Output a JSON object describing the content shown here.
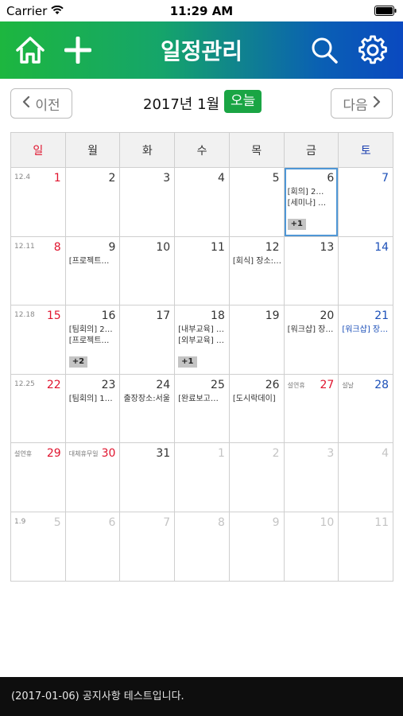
{
  "status": {
    "carrier": "Carrier",
    "time": "11:29 AM"
  },
  "appbar": {
    "title": "일정관리",
    "icons": [
      "home-icon",
      "plus-icon",
      "search-icon",
      "gear-icon"
    ],
    "gradient": [
      "#1db63f",
      "#0a49c0"
    ]
  },
  "nav": {
    "prev_label": "이전",
    "next_label": "다음",
    "month_title": "2017년 1월",
    "today_label": "오늘"
  },
  "weekdays": [
    "일",
    "월",
    "화",
    "수",
    "목",
    "금",
    "토"
  ],
  "weeks": [
    {
      "label": "12.4",
      "days": [
        {
          "num": "1",
          "type": "sun"
        },
        {
          "num": "2"
        },
        {
          "num": "3"
        },
        {
          "num": "4"
        },
        {
          "num": "5"
        },
        {
          "num": "6",
          "selected": true,
          "events": [
            "[회의] 2…",
            "[세미나] …"
          ],
          "more": "+1"
        },
        {
          "num": "7",
          "type": "sat"
        }
      ]
    },
    {
      "label": "12.11",
      "days": [
        {
          "num": "8",
          "type": "sun"
        },
        {
          "num": "9",
          "events": [
            "[프로젝트…"
          ]
        },
        {
          "num": "10"
        },
        {
          "num": "11"
        },
        {
          "num": "12",
          "events": [
            "[회식] 장소:…"
          ]
        },
        {
          "num": "13"
        },
        {
          "num": "14",
          "type": "sat"
        }
      ]
    },
    {
      "label": "12.18",
      "days": [
        {
          "num": "15",
          "type": "sun"
        },
        {
          "num": "16",
          "events": [
            "[팀회의] 2…",
            "[프로젝트…"
          ],
          "more": "+2"
        },
        {
          "num": "17"
        },
        {
          "num": "18",
          "events": [
            "[내부교육] …",
            "[외부교육] …"
          ],
          "more": "+1"
        },
        {
          "num": "19"
        },
        {
          "num": "20",
          "events": [
            "[워크샵] 장…"
          ]
        },
        {
          "num": "21",
          "type": "sat",
          "events": [
            "[워크샵] 장…"
          ]
        }
      ]
    },
    {
      "label": "12.25",
      "days": [
        {
          "num": "22",
          "type": "sun"
        },
        {
          "num": "23",
          "events": [
            "[팀회의] 1…"
          ]
        },
        {
          "num": "24",
          "events": [
            "출장장소:서울"
          ]
        },
        {
          "num": "25",
          "events": [
            "[완료보고…"
          ]
        },
        {
          "num": "26",
          "events": [
            "[도시락데이]"
          ]
        },
        {
          "num": "27",
          "type": "sun",
          "holiday": "설연휴"
        },
        {
          "num": "28",
          "type": "sat",
          "holiday": "설날"
        }
      ]
    },
    {
      "label": "",
      "days": [
        {
          "num": "29",
          "type": "sun",
          "holiday": "설연휴"
        },
        {
          "num": "30",
          "type": "sun",
          "holiday": "대체휴무일"
        },
        {
          "num": "31"
        },
        {
          "num": "1",
          "type": "dim"
        },
        {
          "num": "2",
          "type": "dim"
        },
        {
          "num": "3",
          "type": "dim"
        },
        {
          "num": "4",
          "type": "dim"
        }
      ]
    },
    {
      "label": "1.9",
      "days": [
        {
          "num": "5",
          "type": "dim"
        },
        {
          "num": "6",
          "type": "dim"
        },
        {
          "num": "7",
          "type": "dim"
        },
        {
          "num": "8",
          "type": "dim"
        },
        {
          "num": "9",
          "type": "dim"
        },
        {
          "num": "10",
          "type": "dim"
        },
        {
          "num": "11",
          "type": "dim"
        }
      ]
    }
  ],
  "notice": "(2017-01-06) 공지사항 테스트입니다."
}
